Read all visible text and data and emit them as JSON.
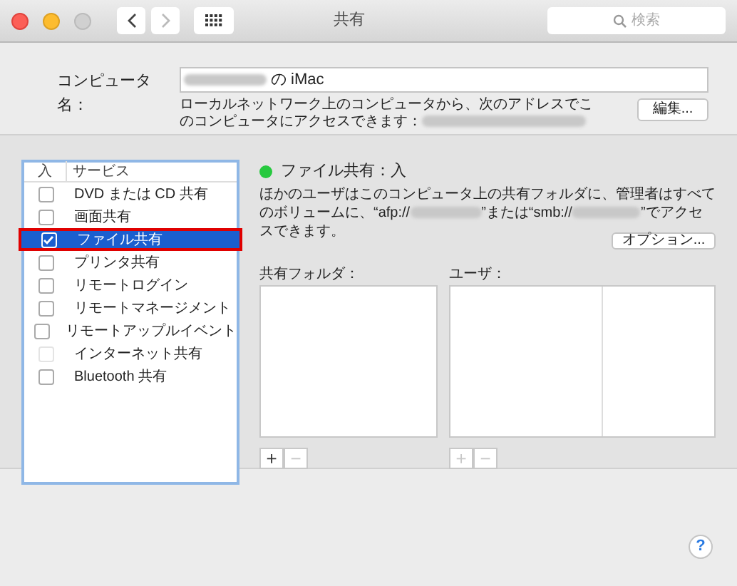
{
  "window": {
    "title": "共有",
    "search": {
      "placeholder": "検索"
    }
  },
  "computer_name": {
    "label": "コンピュータ名：",
    "value": "の iMac",
    "note": "ローカルネットワーク上のコンピュータから、次のアドレスでこのコンピュータにアクセスできます：",
    "edit_button": "編集..."
  },
  "services": {
    "columns": [
      "入",
      "サービス"
    ],
    "items": [
      {
        "name": "DVD または CD 共有",
        "checked": false,
        "selected": false,
        "disabled": false,
        "highlighted": false
      },
      {
        "name": "画面共有",
        "checked": false,
        "selected": false,
        "disabled": false,
        "highlighted": false
      },
      {
        "name": "ファイル共有",
        "checked": true,
        "selected": true,
        "disabled": false,
        "highlighted": true
      },
      {
        "name": "プリンタ共有",
        "checked": false,
        "selected": false,
        "disabled": false,
        "highlighted": false
      },
      {
        "name": "リモートログイン",
        "checked": false,
        "selected": false,
        "disabled": false,
        "highlighted": false
      },
      {
        "name": "リモートマネージメント",
        "checked": false,
        "selected": false,
        "disabled": false,
        "highlighted": false
      },
      {
        "name": "リモートアップルイベント",
        "checked": false,
        "selected": false,
        "disabled": false,
        "highlighted": false
      },
      {
        "name": "インターネット共有",
        "checked": false,
        "selected": false,
        "disabled": true,
        "highlighted": false
      },
      {
        "name": "Bluetooth 共有",
        "checked": false,
        "selected": false,
        "disabled": false,
        "highlighted": false
      }
    ]
  },
  "status": {
    "label": "ファイル共有：入",
    "color": "#27c93f"
  },
  "description": [
    {
      "kind": "text",
      "text": "ほかのユーザはこのコンピュータ上の共有フォルダに、管理者はすべてのボリュームに、“afp://"
    },
    {
      "kind": "redacted"
    },
    {
      "kind": "text",
      "text": "”または“smb://"
    },
    {
      "kind": "redacted"
    },
    {
      "kind": "text",
      "text": "”でアクセスできます。"
    }
  ],
  "options_button": "オプション...",
  "shared_folders": {
    "label": "共有フォルダ：",
    "add": {
      "text": "+",
      "disabled": false
    },
    "remove": {
      "text": "−",
      "disabled": true
    }
  },
  "users": {
    "label": "ユーザ：",
    "add": {
      "text": "+",
      "disabled": true
    },
    "remove": {
      "text": "−",
      "disabled": true
    }
  },
  "help_button": "?"
}
